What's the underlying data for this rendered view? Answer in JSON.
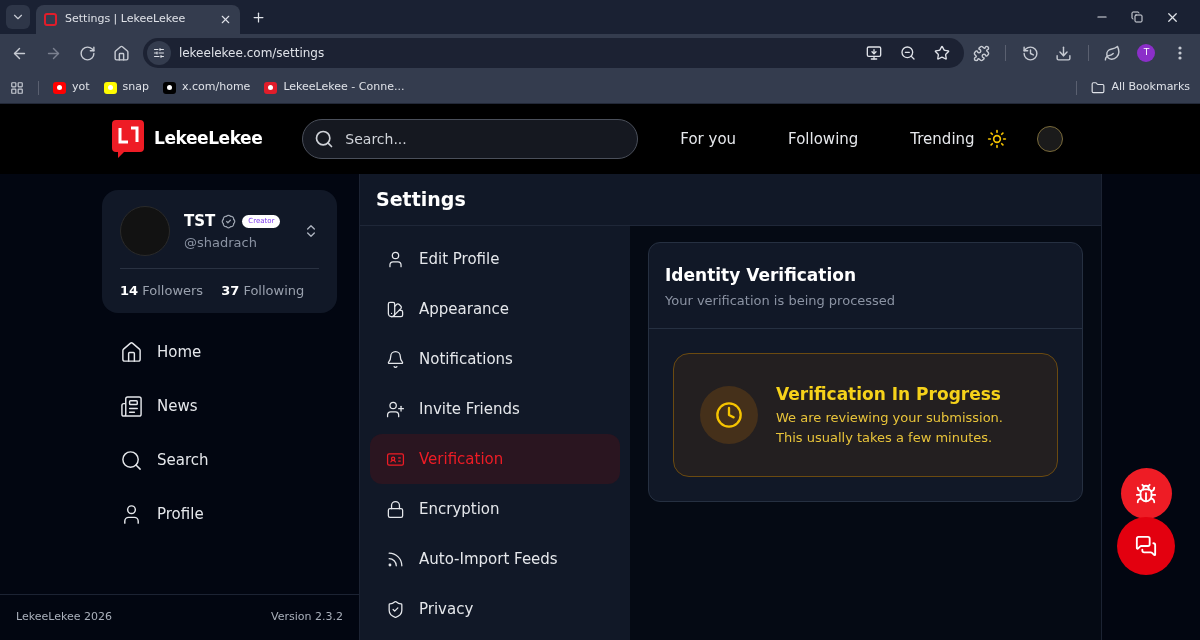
{
  "browser": {
    "tab_title": "Settings | LekeeLekee",
    "url": "lekeelekee.com/settings",
    "profile_initial": "T",
    "bookmarks": [
      {
        "label": "yot",
        "kind": "youtube"
      },
      {
        "label": "snap",
        "kind": "snap"
      },
      {
        "label": "x.com/home",
        "kind": "x"
      },
      {
        "label": "LekeeLekee - Conne...",
        "kind": "site"
      }
    ],
    "all_bookmarks": "All Bookmarks"
  },
  "header": {
    "logo_text": "LekeeLekee",
    "search_placeholder": "Search...",
    "nav": [
      "For you",
      "Following",
      "Trending"
    ]
  },
  "profile": {
    "name": "TST",
    "badge": "Creator",
    "handle": "@shadrach",
    "followers_count": "14",
    "followers_label": "Followers",
    "following_count": "37",
    "following_label": "Following"
  },
  "sidebar": {
    "items": [
      {
        "label": "Home",
        "kind": "home"
      },
      {
        "label": "News",
        "kind": "news"
      },
      {
        "label": "Search",
        "kind": "search"
      },
      {
        "label": "Profile",
        "kind": "profile"
      }
    ],
    "footer_left": "LekeeLekee 2026",
    "footer_right": "Version 2.3.2"
  },
  "settings": {
    "title": "Settings",
    "menu": [
      {
        "label": "Edit Profile",
        "kind": "profile",
        "selected": false
      },
      {
        "label": "Appearance",
        "kind": "appearance",
        "selected": false
      },
      {
        "label": "Notifications",
        "kind": "bell",
        "selected": false
      },
      {
        "label": "Invite Friends",
        "kind": "invite",
        "selected": false
      },
      {
        "label": "Verification",
        "kind": "id",
        "selected": true
      },
      {
        "label": "Encryption",
        "kind": "lock",
        "selected": false
      },
      {
        "label": "Auto-Import Feeds",
        "kind": "rss",
        "selected": false
      },
      {
        "label": "Privacy",
        "kind": "shield",
        "selected": false
      }
    ]
  },
  "verification": {
    "title": "Identity Verification",
    "subtitle": "Your verification is being processed",
    "status_title": "Verification In Progress",
    "status_lines": [
      "We are reviewing your submission.",
      "This usually takes a few minutes."
    ]
  }
}
